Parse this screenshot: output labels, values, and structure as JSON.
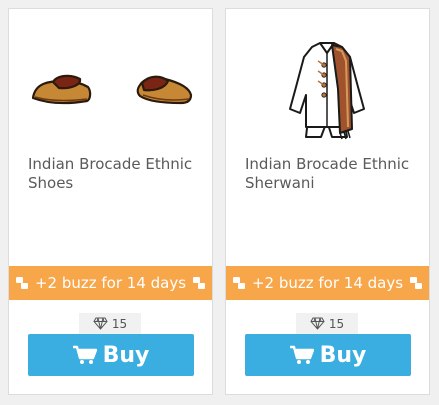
{
  "products": [
    {
      "name": "Indian Brocade Ethnic Shoes",
      "buzz": "+2 buzz for 14 days",
      "price": "15",
      "buy_label": "Buy",
      "icon": "shoes-icon"
    },
    {
      "name": "Indian Brocade Ethnic Sherwani",
      "buzz": "+2 buzz for 14 days",
      "price": "15",
      "buy_label": "Buy",
      "icon": "sherwani-icon"
    }
  ],
  "colors": {
    "buzz_bar": "#f8a64a",
    "buy_button": "#3aaee0",
    "price_bg": "#f1f1f1"
  }
}
